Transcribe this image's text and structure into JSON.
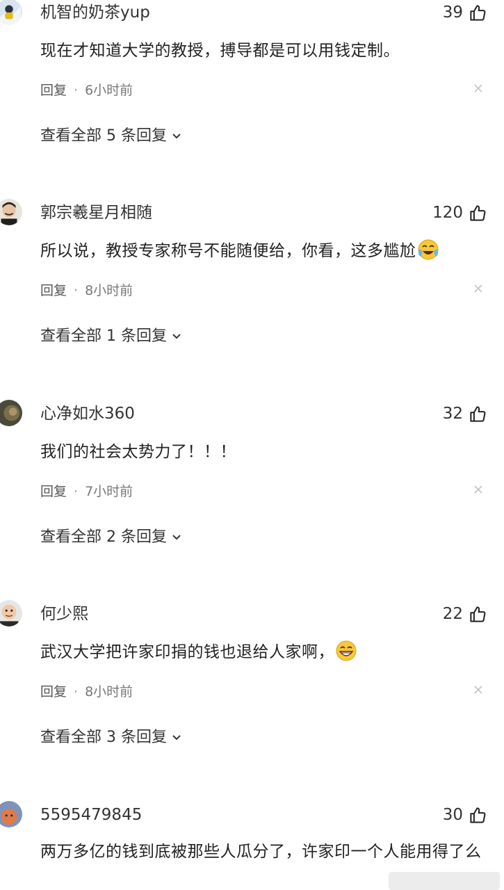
{
  "comments": [
    {
      "username": "机智的奶茶yup",
      "likes": "39",
      "text": "现在才知道大学的教授，搏导都是可以用钱定制。",
      "reply_label": "回复",
      "time": "6小时前",
      "replies_label": "查看全部 5 条回复"
    },
    {
      "username": "郭宗羲星月相随",
      "likes": "120",
      "text": "所以说，教授专家称号不能随便给，你看，这多尴尬",
      "reply_label": "回复",
      "time": "8小时前",
      "replies_label": "查看全部 1 条回复"
    },
    {
      "username": "心净如水360",
      "likes": "32",
      "text": "我们的社会太势力了！！！",
      "reply_label": "回复",
      "time": "7小时前",
      "replies_label": "查看全部 2 条回复"
    },
    {
      "username": "何少熙",
      "likes": "22",
      "text": "武汉大学把许家印捐的钱也退给人家啊，",
      "reply_label": "回复",
      "time": "8小时前",
      "replies_label": "查看全部 3 条回复"
    },
    {
      "username": "5595479845",
      "likes": "30",
      "text": "两万多亿的钱到底被那些人瓜分了，许家印一个人能用得了么"
    }
  ],
  "icons": {
    "like": "thumbs-up-icon",
    "close": "close-icon",
    "expand": "chevron-down-icon",
    "emoji_cry_laugh": "crying-laughing-emoji",
    "emoji_grin": "grinning-emoji"
  },
  "colors": {
    "text": "#222222",
    "meta": "#555555",
    "muted": "#999999",
    "background": "#ffffff"
  }
}
